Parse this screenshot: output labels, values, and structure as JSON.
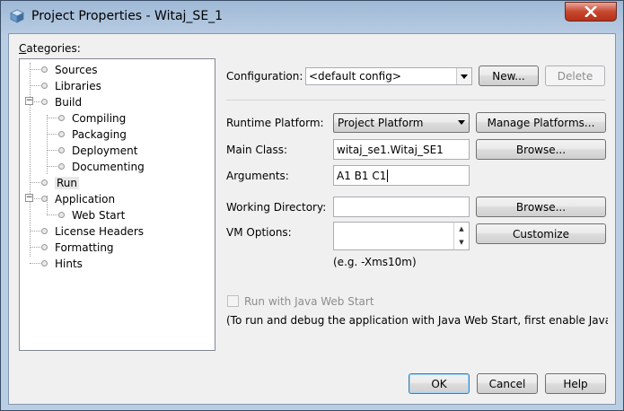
{
  "window": {
    "title": "Project Properties - Witaj_SE_1"
  },
  "categories": {
    "label": "Categories:",
    "items": [
      "Sources",
      "Libraries",
      "Build",
      "Compiling",
      "Packaging",
      "Deployment",
      "Documenting",
      "Run",
      "Application",
      "Web Start",
      "License Headers",
      "Formatting",
      "Hints"
    ],
    "selected": "Run"
  },
  "configuration": {
    "label": "Configuration:",
    "value": "<default config>",
    "new_button": "New...",
    "delete_button": "Delete"
  },
  "runtime_platform": {
    "label": "Runtime Platform:",
    "value": "Project Platform",
    "manage_button": "Manage Platforms..."
  },
  "main_class": {
    "label": "Main Class:",
    "value": "witaj_se1.Witaj_SE1",
    "browse_button": "Browse..."
  },
  "arguments": {
    "label": "Arguments:",
    "value": "A1 B1 C1"
  },
  "working_directory": {
    "label": "Working Directory:",
    "value": "",
    "browse_button": "Browse..."
  },
  "vm_options": {
    "label": "VM Options:",
    "value": "",
    "customize_button": "Customize",
    "hint": "(e.g. -Xms10m)"
  },
  "web_start": {
    "checkbox_label": "Run with Java Web Start",
    "note": "(To run and debug the application with Java Web Start, first enable Java W"
  },
  "footer": {
    "ok": "OK",
    "cancel": "Cancel",
    "help": "Help"
  }
}
